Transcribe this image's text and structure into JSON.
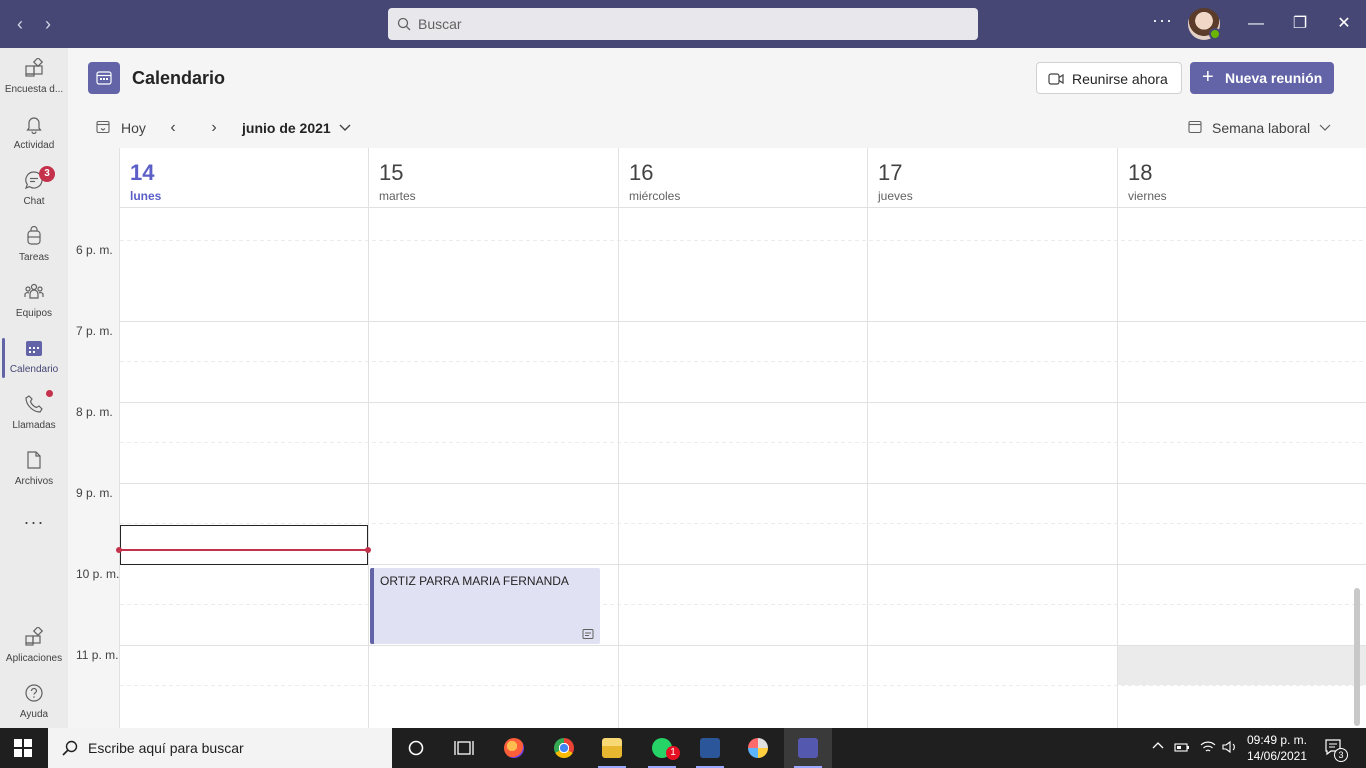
{
  "titlebar": {
    "back_glyph": "‹",
    "forward_glyph": "›",
    "search_placeholder": "Buscar",
    "more_glyph": "···",
    "minimize_glyph": "—",
    "maximize_glyph": "❐",
    "close_glyph": "✕"
  },
  "rail": {
    "items": [
      {
        "label": "Encuesta d...",
        "icon": "apps-add-icon"
      },
      {
        "label": "Actividad",
        "icon": "bell-icon"
      },
      {
        "label": "Chat",
        "icon": "chat-icon",
        "badge": "3"
      },
      {
        "label": "Tareas",
        "icon": "tasks-icon"
      },
      {
        "label": "Equipos",
        "icon": "teams-icon"
      },
      {
        "label": "Calendario",
        "icon": "calendar-icon",
        "active": true
      },
      {
        "label": "Llamadas",
        "icon": "phone-icon",
        "dot": true
      },
      {
        "label": "Archivos",
        "icon": "file-icon"
      }
    ],
    "more_glyph": "···",
    "bottom": [
      {
        "label": "Aplicaciones",
        "icon": "apps-icon"
      },
      {
        "label": "Ayuda",
        "icon": "help-icon"
      }
    ]
  },
  "header": {
    "title": "Calendario",
    "meet_now": "Reunirse ahora",
    "new_meeting": "Nueva reunión",
    "plus": "+"
  },
  "toolbar": {
    "today": "Hoy",
    "prev": "‹",
    "next": "›",
    "month": "junio de 2021",
    "view": "Semana laboral"
  },
  "calendar": {
    "days": [
      {
        "num": "14",
        "name": "lunes",
        "today": true
      },
      {
        "num": "15",
        "name": "martes"
      },
      {
        "num": "16",
        "name": "miércoles"
      },
      {
        "num": "17",
        "name": "jueves"
      },
      {
        "num": "18",
        "name": "viernes"
      }
    ],
    "hours": [
      "6 p. m.",
      "7 p. m.",
      "8 p. m.",
      "9 p. m.",
      "10 p. m.",
      "11 p. m."
    ],
    "events": [
      {
        "title": "ORTIZ PARRA MARIA FERNANDA",
        "day": "15"
      }
    ],
    "colors": {
      "accent": "#6264a7",
      "today_text": "#5b5fc7",
      "now_line": "#c4314b",
      "event_bg": "#e1e1f4",
      "titlebar": "#464775"
    }
  },
  "taskbar": {
    "search_placeholder": "Escribe aquí para buscar",
    "whatsapp_badge": "1",
    "clock_time": "09:49 p. m.",
    "clock_date": "14/06/2021",
    "notifications": "3"
  }
}
